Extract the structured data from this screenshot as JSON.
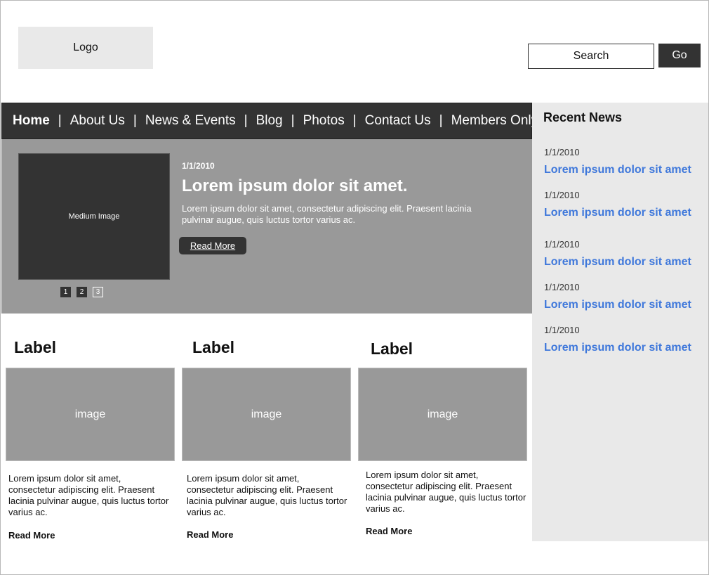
{
  "header": {
    "logo_text": "Logo",
    "search_placeholder": "Search",
    "go_label": "Go"
  },
  "nav": {
    "items": [
      {
        "label": "Home",
        "active": true
      },
      {
        "label": "About Us"
      },
      {
        "label": "News & Events"
      },
      {
        "label": "Blog"
      },
      {
        "label": "Photos"
      },
      {
        "label": "Contact Us"
      },
      {
        "label": "Members Only"
      }
    ],
    "separator": "|"
  },
  "hero": {
    "image_label": "Medium Image",
    "pager": [
      "1",
      "2",
      "3"
    ],
    "date": "1/1/2010",
    "title": "Lorem ipsum dolor sit amet.",
    "text": "Lorem ipsum dolor sit amet, consectetur adipiscing elit. Praesent lacinia pulvinar augue, quis luctus tortor varius ac.",
    "read_more": "Read More"
  },
  "cards": [
    {
      "label": "Label",
      "image_label": "image",
      "text": "Lorem ipsum dolor sit amet, consectetur adipiscing elit. Praesent lacinia pulvinar augue, quis luctus tortor varius ac.",
      "read_more": "Read More"
    },
    {
      "label": "Label",
      "image_label": "image",
      "text": "Lorem ipsum dolor sit amet, consectetur adipiscing elit. Praesent lacinia pulvinar augue, quis luctus tortor varius ac.",
      "read_more": "Read More"
    },
    {
      "label": "Label",
      "image_label": "image",
      "text": "Lorem ipsum dolor sit amet, consectetur adipiscing elit. Praesent lacinia pulvinar augue, quis luctus tortor varius ac.",
      "read_more": "Read More"
    }
  ],
  "sidebar": {
    "title": "Recent News",
    "items": [
      {
        "date": "1/1/2010",
        "link": "Lorem ipsum dolor sit amet"
      },
      {
        "date": "1/1/2010",
        "link": "Lorem ipsum dolor sit amet"
      },
      {
        "date": "1/1/2010",
        "link": "Lorem ipsum dolor sit amet"
      },
      {
        "date": "1/1/2010",
        "link": "Lorem ipsum dolor sit amet"
      },
      {
        "date": "1/1/2010",
        "link": "Lorem ipsum dolor sit amet"
      }
    ]
  },
  "colors": {
    "nav_bg": "#333333",
    "hero_bg": "#999999",
    "sidebar_bg": "#e9e9e9",
    "link": "#3f78db"
  }
}
